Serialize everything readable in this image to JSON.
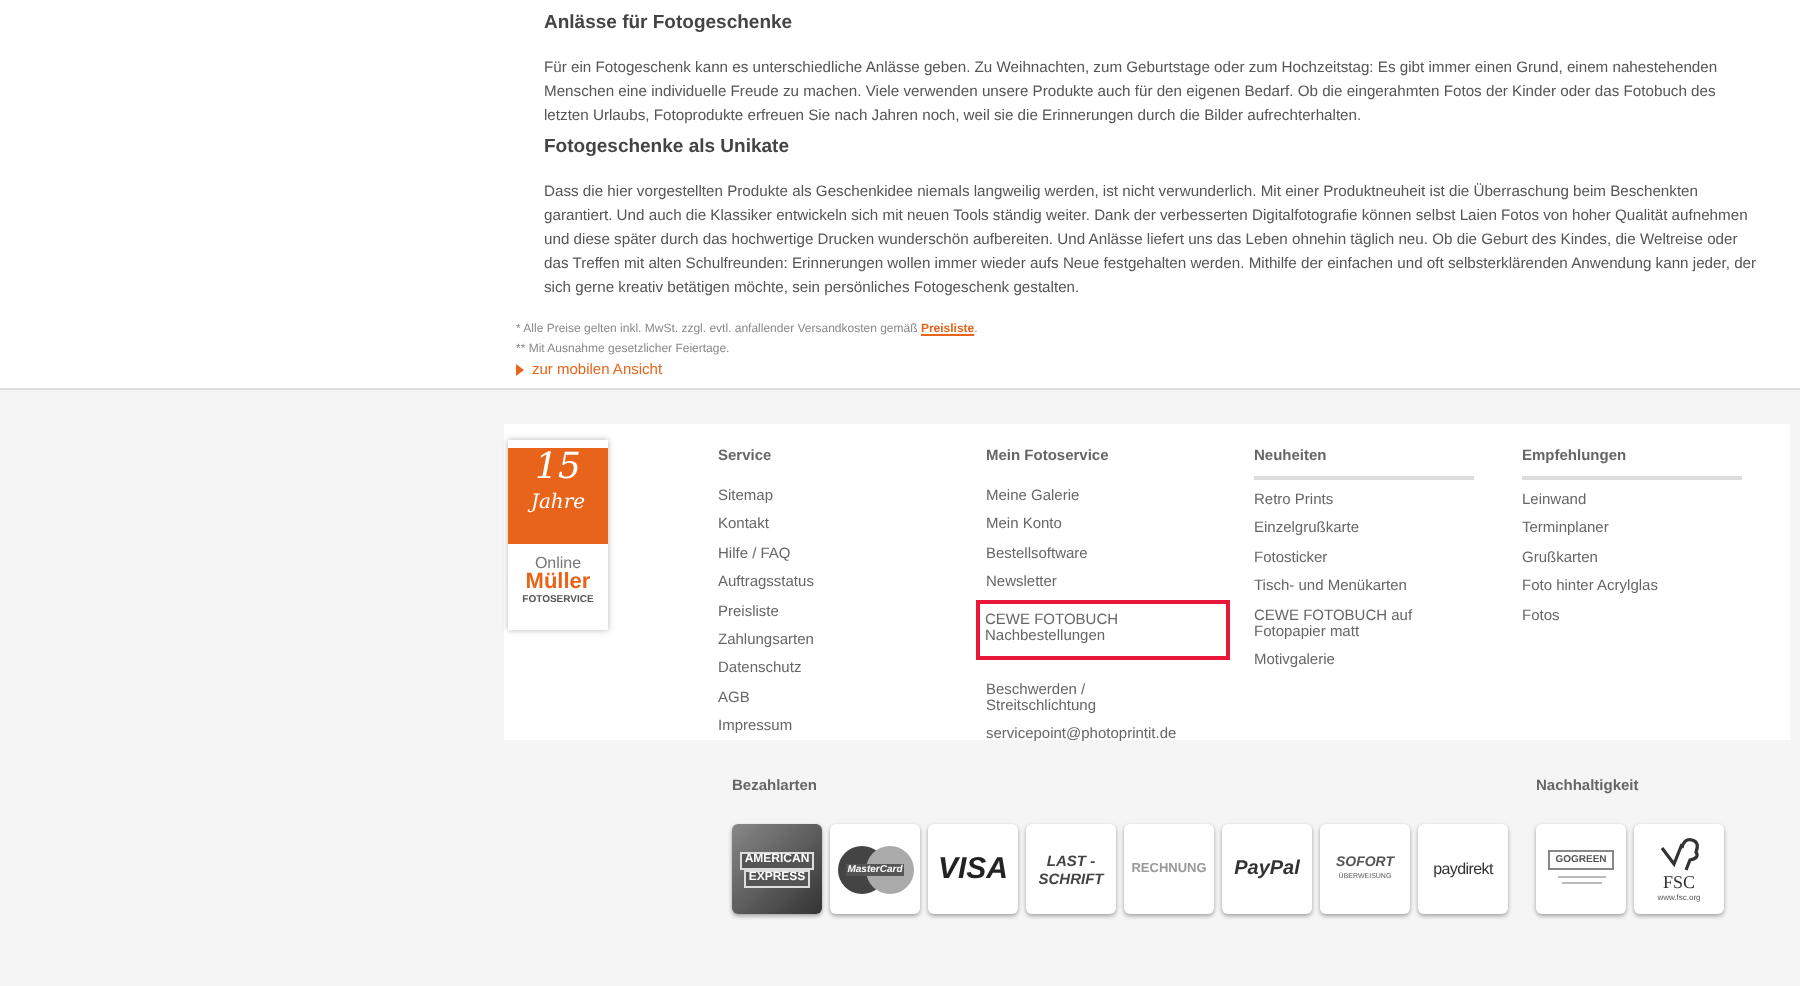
{
  "content": {
    "sections": [
      {
        "heading": "Anlässe für Fotogeschenke",
        "text": "Für ein Fotogeschenk kann es unterschiedliche Anlässe geben. Zu Weihnachten, zum Geburtstage oder zum Hochzeitstag: Es gibt immer einen Grund, einem nahestehenden Menschen eine individuelle Freude zu machen. Viele verwenden unsere Produkte auch für den eigenen Bedarf. Ob die eingerahmten Fotos der Kinder oder das Fotobuch des letzten Urlaubs, Fotoprodukte erfreuen Sie nach Jahren noch, weil sie die Erinnerungen durch die Bilder aufrechterhalten."
      },
      {
        "heading": "Fotogeschenke als Unikate",
        "text": "Dass die hier vorgestellten Produkte als Geschenkidee niemals langweilig werden, ist nicht verwunderlich. Mit einer Produktneuheit ist die Überraschung beim Beschenkten garantiert. Und auch die Klassiker entwickeln sich mit neuen Tools ständig weiter. Dank der verbesserten Digitalfotografie können selbst Laien Fotos von hoher Qualität aufnehmen und diese später durch das hochwertige Drucken wunderschön aufbereiten. Und Anlässe liefert uns das Leben ohnehin täglich neu. Ob die Geburt des Kindes, die Weltreise oder das Treffen mit alten Schulfreunden: Erinnerungen wollen immer wieder aufs Neue festgehalten werden. Mithilfe der einfachen und oft selbsterklärenden Anwendung kann jeder, der sich gerne kreativ betätigen möchte, sein persönliches Fotogeschenk gestalten."
      }
    ]
  },
  "footnotes": {
    "prices": {
      "text": "* Alle Preise gelten inkl. MwSt. zzgl. evtl. anfallender Versandkosten gemäß ",
      "link": "Preisliste",
      "end": "."
    },
    "holidays": "** Mit Ausnahme gesetzlicher Feiertage.",
    "mobile_link": "zur mobilen Ansicht"
  },
  "logo": {
    "number": "15",
    "word": "Jahre",
    "line1": "Online",
    "brand": "Müller",
    "line2": "FOTOSERVICE"
  },
  "columns": [
    {
      "heading": "Service",
      "links": [
        {
          "label": "Sitemap",
          "highlighted": false
        },
        {
          "label": "Kontakt",
          "highlighted": false
        },
        {
          "label": "Hilfe / FAQ",
          "highlighted": false
        },
        {
          "label": "Auftragsstatus",
          "highlighted": false
        },
        {
          "label": "Preisliste",
          "highlighted": false
        },
        {
          "label": "Zahlungsarten",
          "highlighted": false
        },
        {
          "label": "Datenschutz",
          "highlighted": false
        },
        {
          "label": "AGB",
          "highlighted": false
        },
        {
          "label": "Impressum",
          "highlighted": false
        }
      ]
    },
    {
      "heading": "Mein Fotoservice",
      "links": [
        {
          "label": "Meine Galerie",
          "highlighted": false
        },
        {
          "label": "Mein Konto",
          "highlighted": false
        },
        {
          "label": "Bestellsoftware",
          "highlighted": false
        },
        {
          "label": "Newsletter",
          "highlighted": false
        },
        {
          "label": "CEWE FOTOBUCH Nachbestellungen",
          "highlighted": true
        },
        {
          "label": "Beschwerden / Streitschlichtung",
          "highlighted": false
        },
        {
          "label": "servicepoint@photoprintit.de",
          "highlighted": false
        }
      ]
    },
    {
      "heading": "Neuheiten",
      "links": [
        {
          "label": "Retro Prints",
          "highlighted": false
        },
        {
          "label": "Einzelgrußkarte",
          "highlighted": false
        },
        {
          "label": "Fotosticker",
          "highlighted": false
        },
        {
          "label": "Tisch- und Menükarten",
          "highlighted": false
        },
        {
          "label": "CEWE FOTOBUCH auf Fotopapier matt",
          "highlighted": false
        },
        {
          "label": "Motivgalerie",
          "highlighted": false
        }
      ]
    },
    {
      "heading": "Empfehlungen",
      "links": [
        {
          "label": "Leinwand",
          "highlighted": false
        },
        {
          "label": "Terminplaner",
          "highlighted": false
        },
        {
          "label": "Grußkarten",
          "highlighted": false
        },
        {
          "label": "Foto hinter Acrylglas",
          "highlighted": false
        },
        {
          "label": "Fotos",
          "highlighted": false
        }
      ]
    }
  ],
  "payment": {
    "heading": "Bezahlarten",
    "methods": [
      {
        "kind": "amex",
        "lines": [
          "AMERICAN",
          "EXPRESS"
        ]
      },
      {
        "kind": "mastercard",
        "lines": [
          "MasterCard"
        ]
      },
      {
        "kind": "visa",
        "lines": [
          "VISA"
        ]
      },
      {
        "kind": "lastschrift",
        "lines": [
          "LAST -",
          "SCHRIFT"
        ]
      },
      {
        "kind": "rechnung",
        "lines": [
          "RECHNUNG"
        ]
      },
      {
        "kind": "paypal",
        "lines": [
          "PayPal"
        ]
      },
      {
        "kind": "sofort",
        "lines": [
          "SOFORT",
          "ÜBERWEISUNG"
        ]
      },
      {
        "kind": "paydirekt",
        "lines": [
          "paydirekt"
        ]
      }
    ]
  },
  "sustainability": {
    "heading": "Nachhaltigkeit",
    "badges": [
      {
        "kind": "gogreen",
        "lines": [
          "GOGREEN"
        ]
      },
      {
        "kind": "fsc",
        "lines": [
          "FSC",
          "www.fsc.org"
        ]
      }
    ]
  }
}
